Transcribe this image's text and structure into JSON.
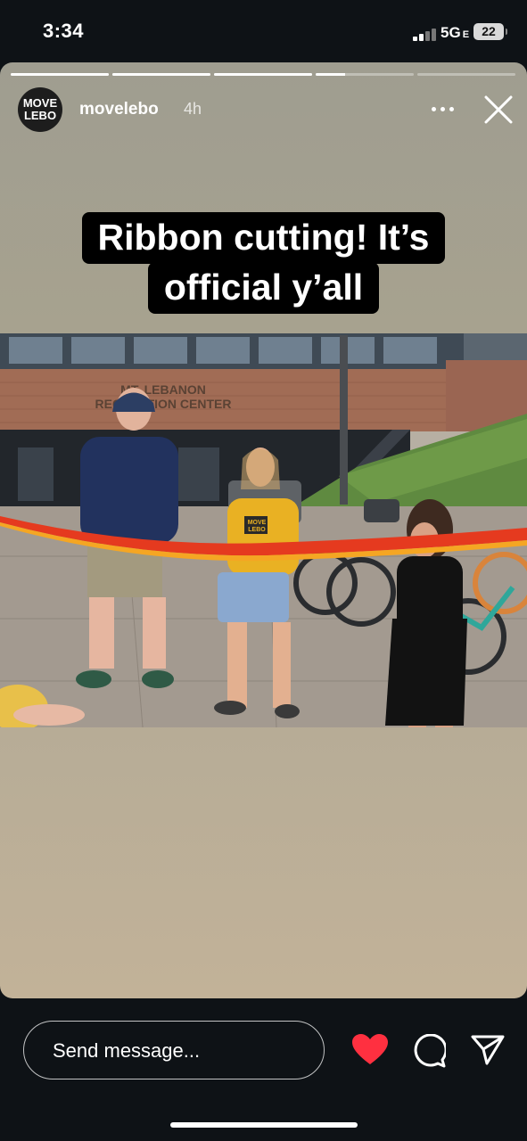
{
  "status_bar": {
    "time": "3:34",
    "network": "5G",
    "network_suffix": "E",
    "battery": "22"
  },
  "story": {
    "username": "movelebo",
    "age": "4h",
    "avatar_text_line1": "MOVE",
    "avatar_text_line2": "LEBO",
    "progress": [
      1,
      1,
      1,
      0.3,
      0
    ],
    "caption_line1": "Ribbon cutting! It’s",
    "caption_line2": "official y’all",
    "photo": {
      "sign_line1": "MT. LEBANON",
      "sign_line2": "RECREATION CENTER",
      "shirt_text_line1": "MOVE",
      "shirt_text_line2": "LEBO"
    }
  },
  "reply": {
    "placeholder": "Send message..."
  },
  "colors": {
    "like_heart": "#ff3040",
    "background": "#0e1216"
  },
  "icons": [
    "more-icon",
    "close-icon",
    "heart-icon",
    "comment-icon",
    "send-icon"
  ]
}
